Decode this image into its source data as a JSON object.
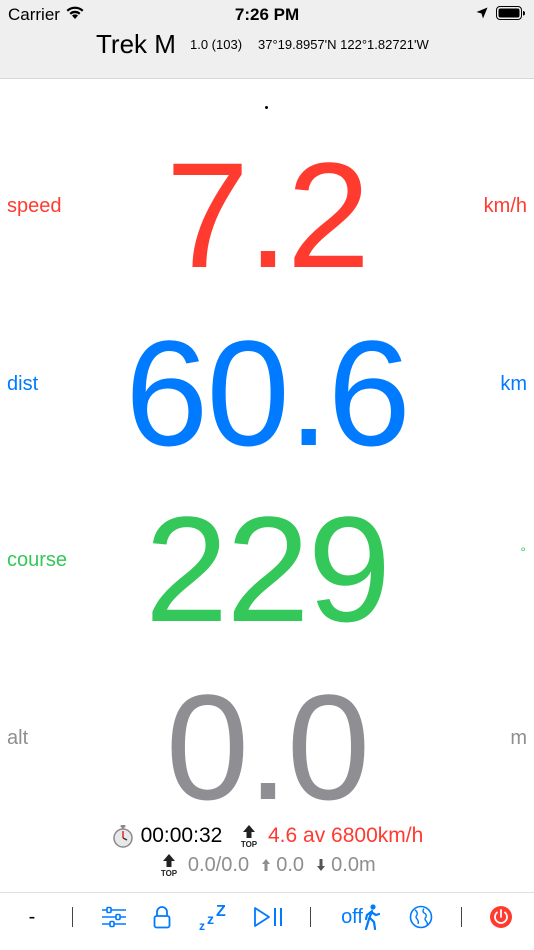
{
  "status_bar": {
    "carrier": "Carrier",
    "time": "7:26 PM"
  },
  "header": {
    "title": "Trek M",
    "version": "1.0 (103)",
    "coordinates": "37°19.8957'N 122°1.82721'W"
  },
  "metrics": {
    "speed": {
      "label": "speed",
      "value": "7.2",
      "unit": "km/h",
      "color": "#ff3b30"
    },
    "dist": {
      "label": "dist",
      "value": "60.6",
      "unit": "km",
      "color": "#007aff"
    },
    "course": {
      "label": "course",
      "value": "229",
      "unit": "°",
      "color": "#34c759"
    },
    "alt": {
      "label": "alt",
      "value": "0.0",
      "unit": "m",
      "color": "#8e8e93"
    }
  },
  "stats": {
    "timer": "00:00:32",
    "top_label": "TOP",
    "top_speed": "4.6 av 6800km/h",
    "top_alt": "0.0/0.0",
    "climb": "0.0",
    "descent": "0.0m"
  },
  "toolbar": {
    "minus": "-",
    "off": "off",
    "icons": [
      "settings-sliders-icon",
      "lock-icon",
      "sleep-zzz-icon",
      "play-pause-icon",
      "walk-icon",
      "globe-icon",
      "power-icon"
    ]
  }
}
